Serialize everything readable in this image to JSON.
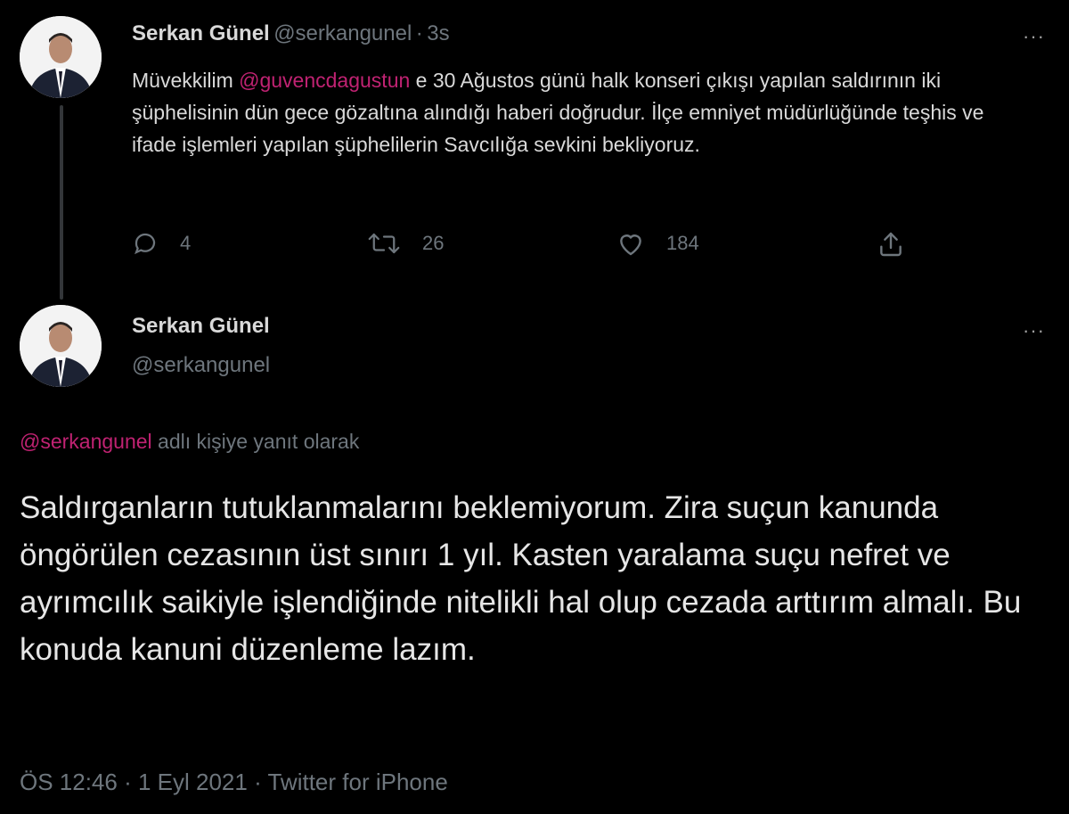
{
  "tweet1": {
    "name": "Serkan Günel",
    "handle": "@serkangunel",
    "separator": "·",
    "time": "3s",
    "text_before": "Müvekkilim ",
    "mention": "@guvencdagustun",
    "text_after": " e 30 Ağustos günü halk konseri çıkışı yapılan saldırının iki şüphelisinin dün gece gözaltına alındığı haberi doğrudur. İlçe emniyet müdürlüğünde teşhis ve ifade işlemleri yapılan şüphelilerin Savcılığa sevkini bekliyoruz.",
    "more": "···",
    "actions": {
      "reply_count": "4",
      "retweet_count": "26",
      "like_count": "184"
    }
  },
  "tweet2": {
    "name": "Serkan Günel",
    "handle": "@serkangunel",
    "more": "···",
    "reply_to_handle": "@serkangunel",
    "reply_to_text": " adlı kişiye yanıt olarak",
    "text": "Saldırganların tutuklanmalarını beklemiyorum. Zira suçun kanunda öngörülen cezasının üst sınırı 1 yıl. Kasten yaralama suçu nefret ve ayrımcılık saikiyle işlendiğinde nitelikli hal olup cezada arttırım almalı. Bu konuda kanuni düzenleme lazım.",
    "meta_time": "ÖS 12:46",
    "meta_sep1": " · ",
    "meta_date": "1 Eyl 2021",
    "meta_sep2": " · ",
    "meta_source": "Twitter for iPhone"
  },
  "colors": {
    "background": "#000000",
    "mention": "#c02272",
    "muted": "#6e767d",
    "text": "#d9d9d9"
  }
}
